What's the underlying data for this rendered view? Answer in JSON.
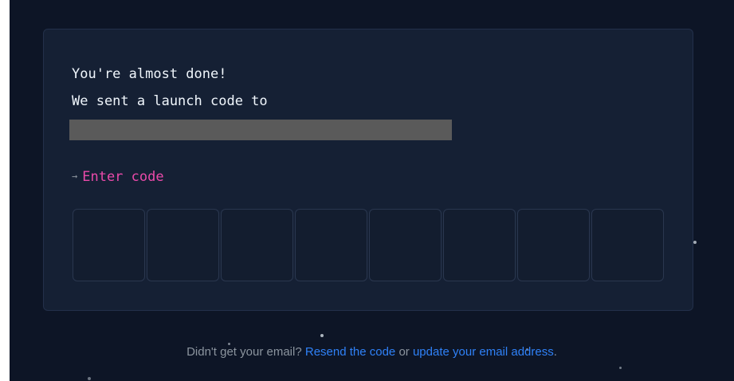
{
  "card": {
    "heading_line1": "You're almost done!",
    "heading_line2": "We sent a launch code to",
    "enter_code_arrow": "→",
    "enter_code_label": "Enter code",
    "code_box_count": 8
  },
  "footer": {
    "prefix": "Didn't get your email?",
    "resend_link": "Resend the code",
    "middle": "or",
    "update_link": "update your email address",
    "suffix": "."
  },
  "colors": {
    "background": "#0d1526",
    "card": "#152034",
    "accent_pink": "#ea4aaa",
    "link_blue": "#2f81f7",
    "muted_text": "#8b949e"
  },
  "icons": {
    "enter_code_prefix": "arrow-right-icon"
  }
}
